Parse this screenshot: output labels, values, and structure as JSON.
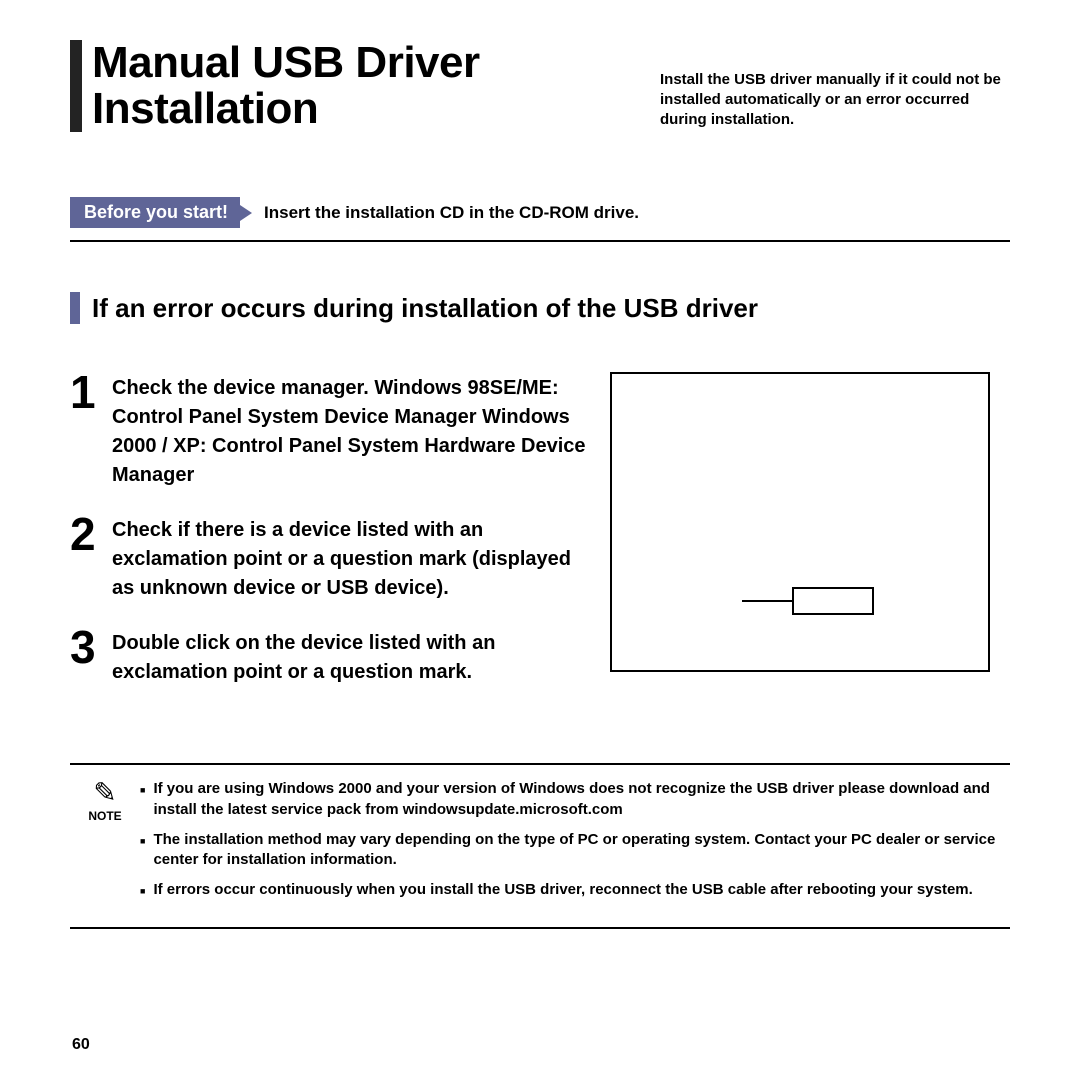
{
  "header": {
    "title": "Manual USB Driver Installation",
    "subtitle": "Install the USB driver manually if it could not be installed automatically or an error occurred during installation."
  },
  "before": {
    "badge": "Before you start!",
    "text": "Insert the installation CD in the CD-ROM drive."
  },
  "section": {
    "heading": "If an error occurs during installation of the USB driver"
  },
  "steps": [
    {
      "num": "1",
      "text": "Check the device manager. Windows 98SE/ME: Control Panel   System   Device Manager Windows 2000 / XP: Control Panel   System   Hardware   Device Manager"
    },
    {
      "num": "2",
      "text": "Check if there is a device listed with an exclamation point or a question mark (displayed as unknown device or USB device)."
    },
    {
      "num": "3",
      "text": "Double click on the device listed with an exclamation point or a question mark."
    }
  ],
  "note": {
    "label": "NOTE",
    "items": [
      "If you are using Windows 2000 and your version of Windows does not recognize the USB driver please download and install the latest service pack from windowsupdate.microsoft.com",
      "The installation method may vary depending on the type of PC or operating system. Contact your PC dealer or service center for installation information.",
      "If errors occur continuously when you install the USB driver, reconnect the USB cable after rebooting your system."
    ]
  },
  "page_number": "60"
}
